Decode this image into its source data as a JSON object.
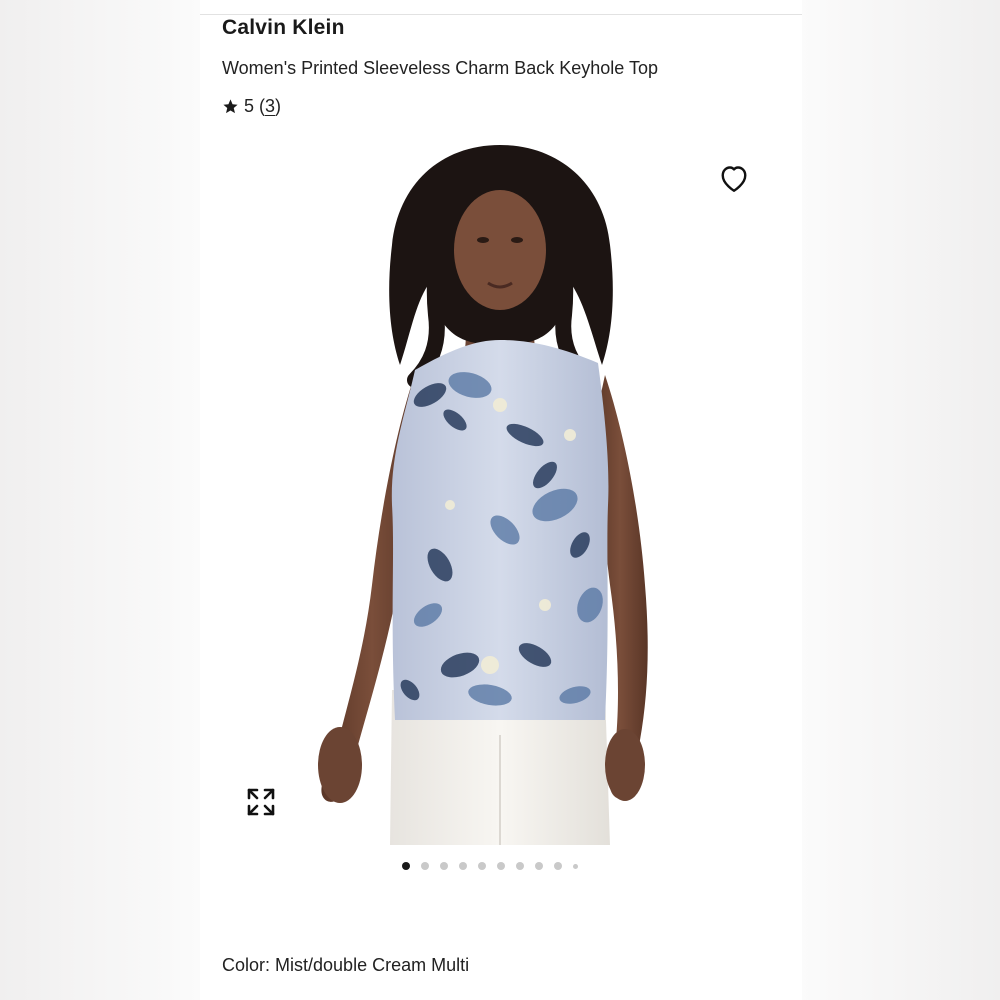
{
  "product": {
    "brand": "Calvin Klein",
    "title": "Women's Printed Sleeveless Charm Back Keyhole Top",
    "rating_value": "5",
    "review_count_open": "(",
    "review_count": "3",
    "review_count_close": ")",
    "color_label": "Color:",
    "color_value": "Mist/double Cream Multi"
  },
  "gallery": {
    "image_alt": "Model wearing a sleeveless floral printed top in mist blue with white pants",
    "total_images": 10,
    "active_index": 0
  },
  "icons": {
    "rating": "star-icon",
    "favorite": "heart-outline-icon",
    "expand": "expand-arrows-icon"
  },
  "colors": {
    "text": "#1a1a1a",
    "dot_active": "#1a1a1a",
    "dot_inactive": "#c9c9c9",
    "top_fabric": "#c9d1e3",
    "print_dark": "#2a3d5e",
    "print_mid": "#5b7aa6",
    "pants": "#f4f2ee",
    "skin": "#6b4433",
    "hair": "#1c1412"
  }
}
